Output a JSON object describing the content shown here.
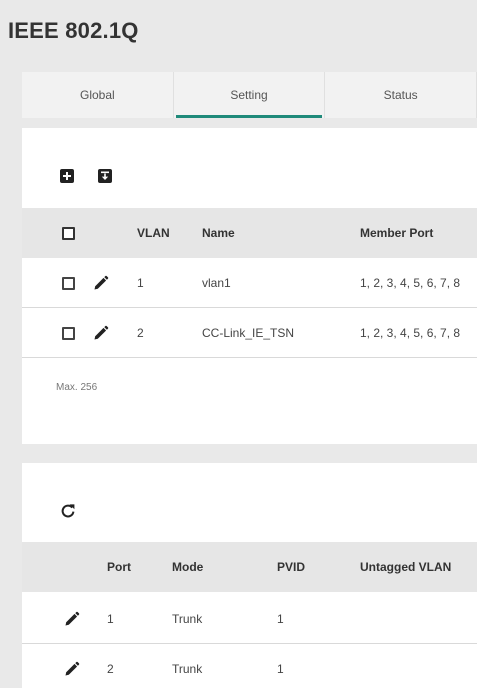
{
  "page": {
    "title": "IEEE 802.1Q"
  },
  "tabs": [
    {
      "label": "Global"
    },
    {
      "label": "Setting"
    },
    {
      "label": "Status"
    }
  ],
  "active_tab": "Setting",
  "vlan_table": {
    "headers": {
      "vlan": "VLAN",
      "name": "Name",
      "member_port": "Member Port"
    },
    "rows": [
      {
        "vlan": "1",
        "name": "vlan1",
        "member_port": "1, 2, 3, 4, 5, 6, 7, 8"
      },
      {
        "vlan": "2",
        "name": "CC-Link_IE_TSN",
        "member_port": "1, 2, 3, 4, 5, 6, 7, 8"
      }
    ],
    "max_note": "Max. 256"
  },
  "port_table": {
    "headers": {
      "port": "Port",
      "mode": "Mode",
      "pvid": "PVID",
      "untagged_vlan": "Untagged VLAN"
    },
    "rows": [
      {
        "port": "1",
        "mode": "Trunk",
        "pvid": "1",
        "untagged_vlan": ""
      },
      {
        "port": "2",
        "mode": "Trunk",
        "pvid": "1",
        "untagged_vlan": ""
      }
    ]
  },
  "icons": {
    "add": "add-box-icon",
    "import": "import-box-icon",
    "edit": "pencil-icon",
    "refresh": "refresh-icon"
  },
  "colors": {
    "accent": "#1f8a7a",
    "header_bg": "#e6e6e6",
    "page_bg": "#e9e9e9"
  }
}
